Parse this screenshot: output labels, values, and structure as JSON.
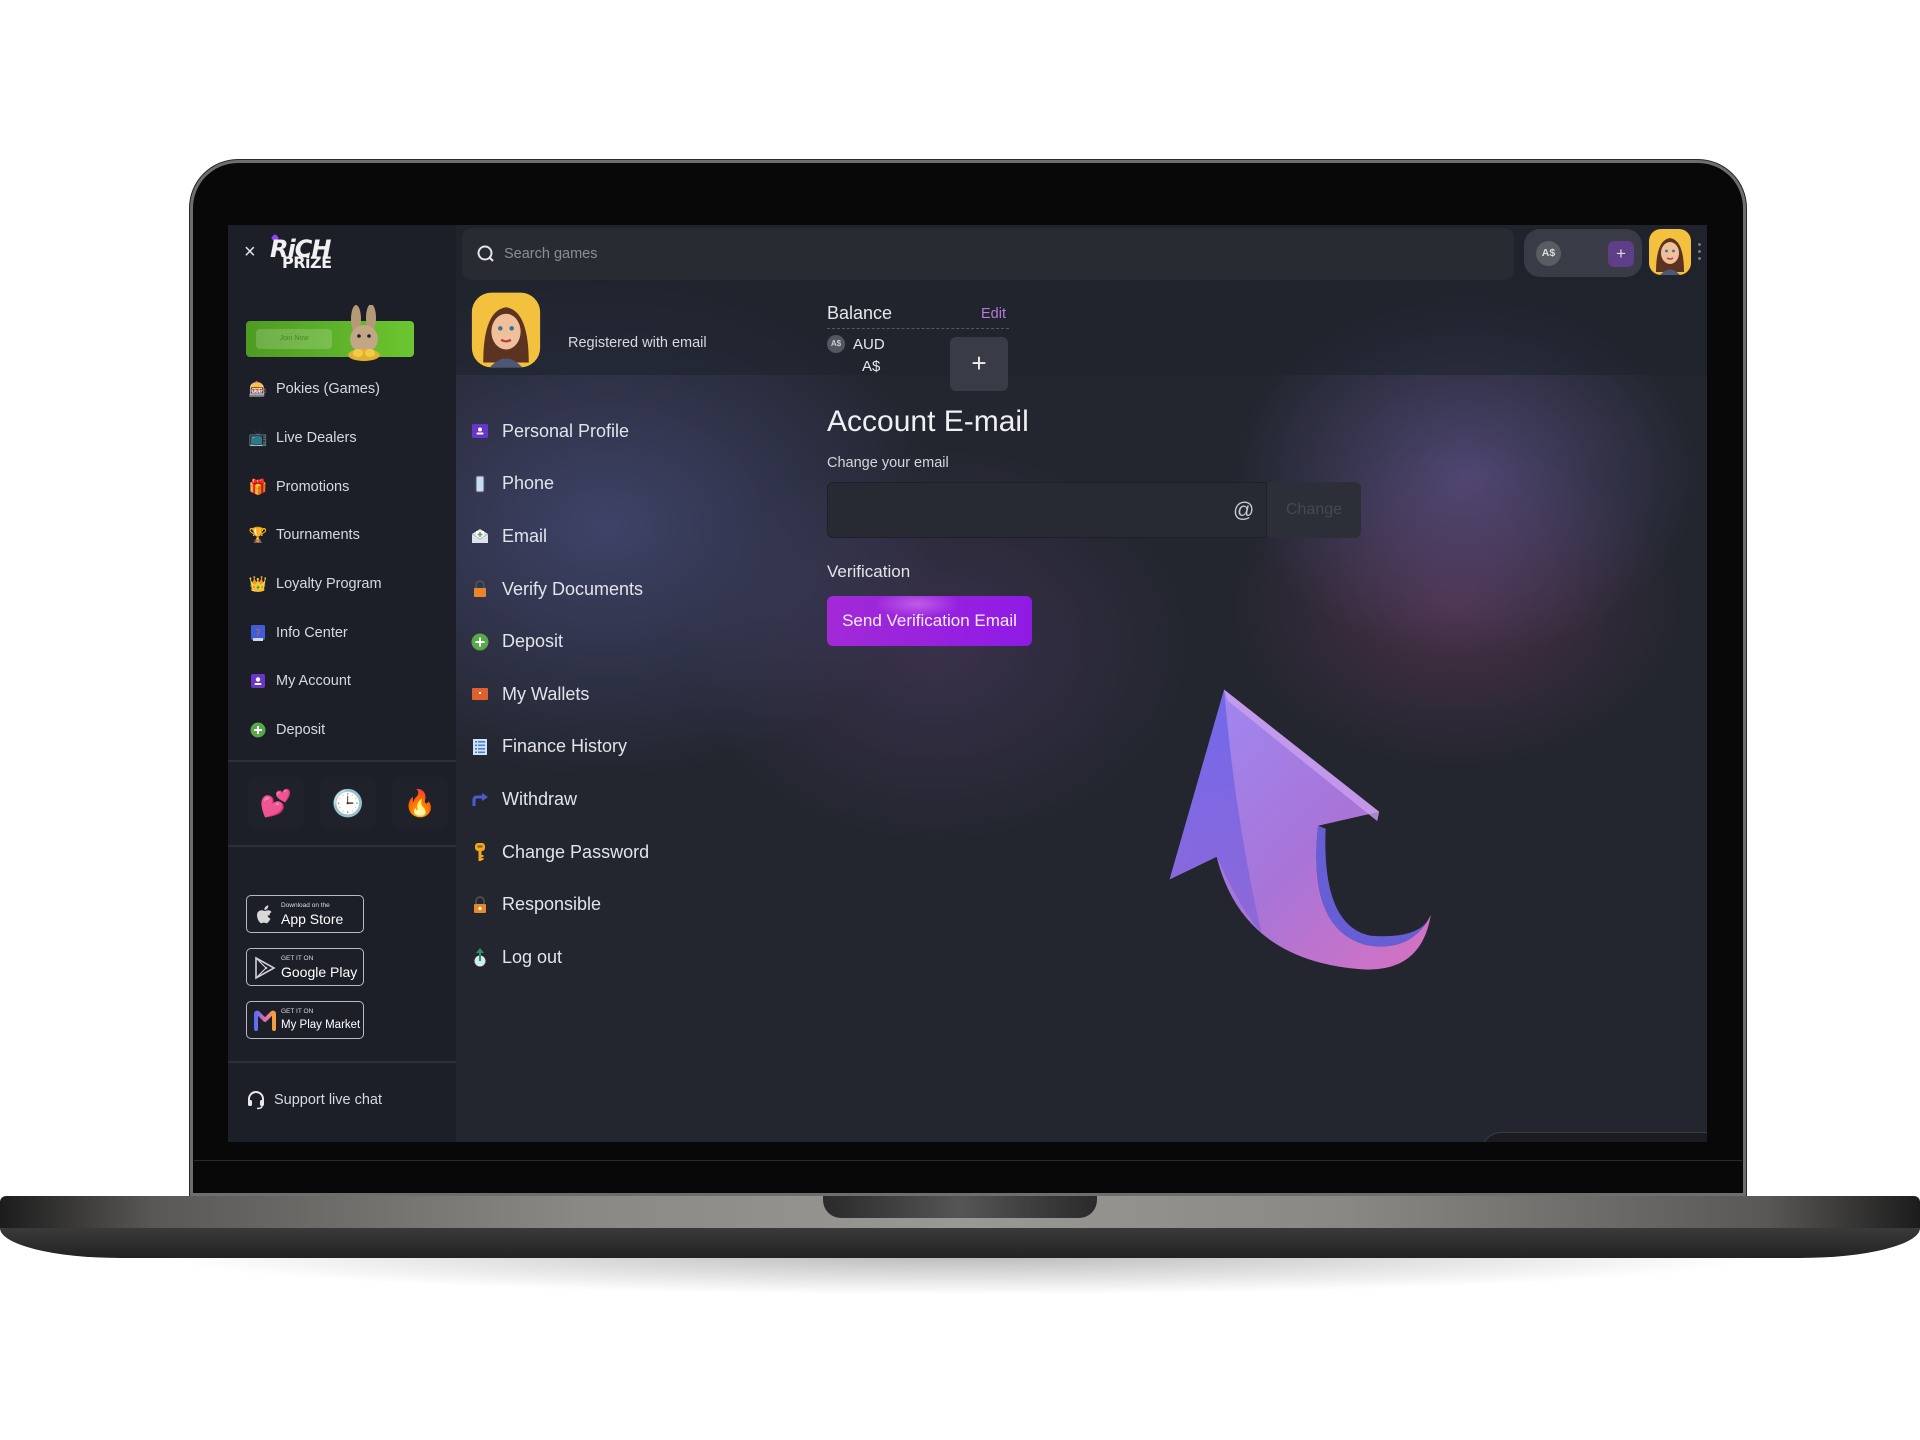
{
  "brand": {
    "name_line1": "RiCH",
    "name_line2": "PRiZE",
    "accent": "#8f1ae6",
    "link_color": "#b57ad7"
  },
  "sidebar": {
    "close_label": "×",
    "banner": {
      "cta": "Join Now"
    },
    "nav": [
      {
        "label": "Pokies (Games)",
        "icon": "slot-machine-icon",
        "glyph": "🎰"
      },
      {
        "label": "Live Dealers",
        "icon": "live-tv-icon",
        "glyph": "📺"
      },
      {
        "label": "Promotions",
        "icon": "gift-icon",
        "glyph": "🎁"
      },
      {
        "label": "Tournaments",
        "icon": "trophy-icon",
        "glyph": "🏆"
      },
      {
        "label": "Loyalty Program",
        "icon": "crown-icon",
        "glyph": "👑"
      },
      {
        "label": "Info Center",
        "icon": "question-book-icon",
        "glyph": "❓"
      },
      {
        "label": "My Account",
        "icon": "account-icon",
        "glyph": "👤"
      },
      {
        "label": "Deposit",
        "icon": "plus-circle-icon",
        "glyph": "➕"
      }
    ],
    "quick": [
      {
        "icon": "hearts-icon",
        "glyph": "💕"
      },
      {
        "icon": "clock-history-icon",
        "glyph": "🕒"
      },
      {
        "icon": "fire-icon",
        "glyph": "🔥"
      }
    ],
    "stores": [
      {
        "small": "Download on the",
        "big": "App Store",
        "icon": "apple-icon"
      },
      {
        "small": "GET IT ON",
        "big": "Google Play",
        "icon": "google-play-icon"
      },
      {
        "small": "GET IT ON",
        "big": "My Play Market",
        "icon": "my-play-market-icon"
      }
    ],
    "support_label": "Support live chat"
  },
  "topbar": {
    "search_placeholder": "Search games",
    "currency_badge": "A$",
    "add_label": "+"
  },
  "profile": {
    "registered_text": "Registered with email",
    "balance_label": "Balance",
    "edit_label": "Edit",
    "currency_badge": "A$",
    "currency_code": "AUD",
    "currency_symbol": "A$",
    "add_label": "+"
  },
  "account_menu": [
    {
      "label": "Personal Profile",
      "icon": "profile-card-icon"
    },
    {
      "label": "Phone",
      "icon": "phone-icon"
    },
    {
      "label": "Email",
      "icon": "envelope-icon"
    },
    {
      "label": "Verify Documents",
      "icon": "lock-icon"
    },
    {
      "label": "Deposit",
      "icon": "plus-circle-icon"
    },
    {
      "label": "My Wallets",
      "icon": "wallet-icon"
    },
    {
      "label": "Finance History",
      "icon": "list-icon"
    },
    {
      "label": "Withdraw",
      "icon": "arrow-turn-icon"
    },
    {
      "label": "Change Password",
      "icon": "key-icon"
    },
    {
      "label": "Responsible",
      "icon": "padlock-icon"
    },
    {
      "label": "Log out",
      "icon": "logout-icon"
    }
  ],
  "email_section": {
    "title": "Account E-mail",
    "change_label": "Change your email",
    "email_value": "",
    "email_placeholder": "",
    "at_symbol": "@",
    "change_button": "Change",
    "verification_label": "Verification",
    "send_button": "Send Verification Email"
  }
}
